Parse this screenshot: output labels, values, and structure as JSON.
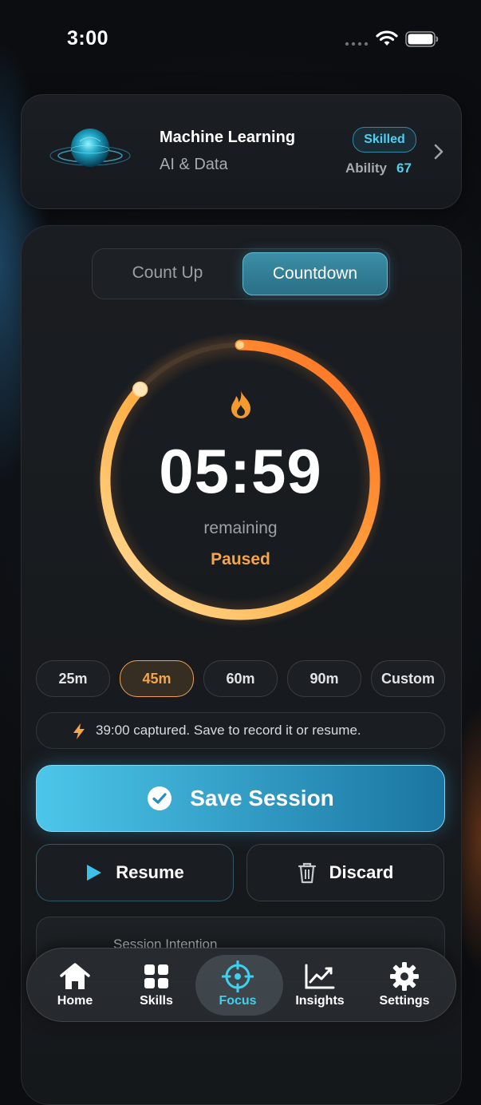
{
  "status_bar": {
    "time": "3:00"
  },
  "skill": {
    "title": "Machine Learning",
    "category": "AI & Data",
    "level_badge": "Skilled",
    "ability_label": "Ability",
    "ability_value": "67",
    "icon": "orb-icon"
  },
  "mode_toggle": {
    "options": [
      "Count Up",
      "Countdown"
    ],
    "selected": "Countdown"
  },
  "timer": {
    "display": "05:59",
    "caption": "remaining",
    "state": "Paused",
    "progress_elapsed_fraction": 0.867,
    "icon": "flame-icon"
  },
  "durations": {
    "options": [
      "25m",
      "45m",
      "60m",
      "90m",
      "Custom"
    ],
    "selected": "45m"
  },
  "info": {
    "text": "39:00 captured. Save to record it or resume.",
    "icon": "lightning-icon"
  },
  "actions": {
    "save": "Save Session",
    "resume": "Resume",
    "discard": "Discard"
  },
  "intention": {
    "label": "Session Intention"
  },
  "tabs": [
    {
      "label": "Home",
      "icon": "home-icon"
    },
    {
      "label": "Skills",
      "icon": "grid-icon"
    },
    {
      "label": "Focus",
      "icon": "crosshair-icon",
      "active": true
    },
    {
      "label": "Insights",
      "icon": "chart-icon"
    },
    {
      "label": "Settings",
      "icon": "gear-icon"
    }
  ],
  "colors": {
    "accent": "#3fd0ee",
    "warning": "#f5a54a",
    "ring_start": "#ff6a20",
    "ring_end": "#ffe0a0"
  }
}
